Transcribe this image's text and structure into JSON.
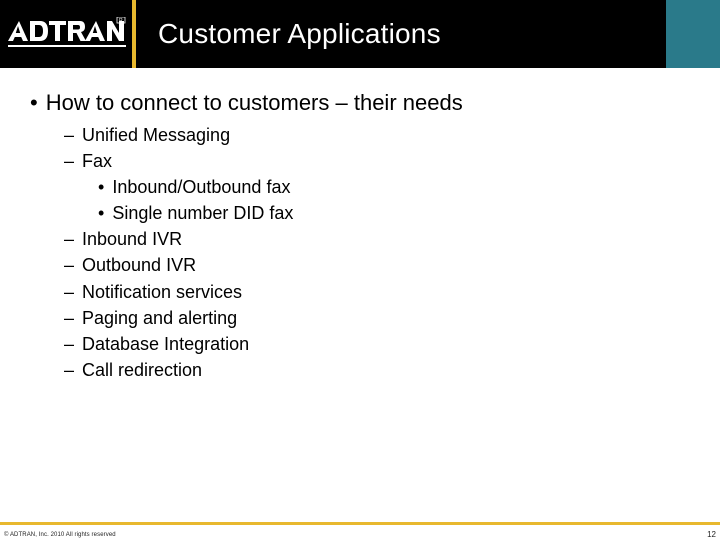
{
  "brand": "ADTRAN",
  "title": "Customer Applications",
  "bullet1": "How to connect to customers – their needs",
  "items": {
    "um": "Unified Messaging",
    "fax": "Fax",
    "fax_inout": "Inbound/Outbound fax",
    "fax_did": "Single number DID fax",
    "inivr": "Inbound IVR",
    "outivr": "Outbound IVR",
    "notif": "Notification services",
    "paging": "Paging and alerting",
    "db": "Database Integration",
    "redir": "Call redirection"
  },
  "copyright": "© ADTRAN, Inc. 2010 All rights reserved",
  "page": "12"
}
